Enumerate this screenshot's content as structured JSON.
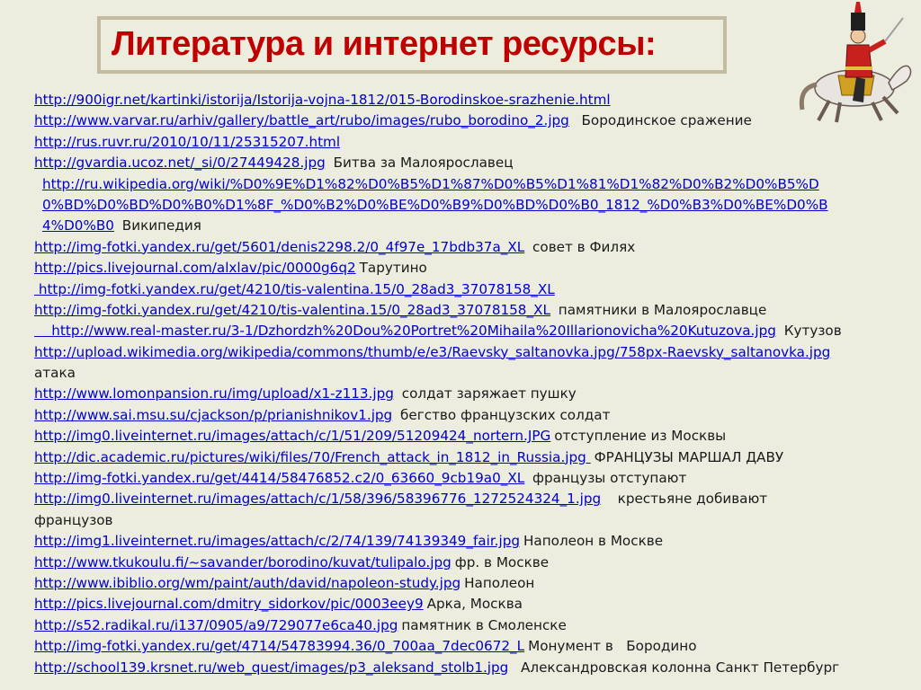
{
  "title": "Литература и интернет ресурсы:",
  "lines": [
    {
      "url": "http://900igr.net/kartinki/istorija/Istorija-vojna-1812/015-Borodinskoe-srazhenie.html",
      "desc": ""
    },
    {
      "url": "http://www.varvar.ru/arhiv/gallery/battle_art/rubo/images/rubo_borodino_2.jpg",
      "desc": "  Бородинское сражение"
    },
    {
      "url": "http://rus.ruvr.ru/2010/10/11/25315207.html",
      "desc": ""
    },
    {
      "url": "http://gvardia.ucoz.net/_si/0/27449428.jpg",
      "desc": " Битва за Малоярославец"
    },
    {
      "url": "http://ru.wikipedia.org/wiki/%D0%9E%D1%82%D0%B5%D1%87%D0%B5%D1%81%D1%82%D0%B2%D0%B5%D",
      "desc": "",
      "indent": true
    },
    {
      "url": "0%BD%D0%BD%D0%B0%D1%8F_%D0%B2%D0%BE%D0%B9%D0%BD%D0%B0_1812_%D0%B3%D0%BE%D0%B",
      "desc": "",
      "indent": true
    },
    {
      "url": "4%D0%B0",
      "desc": " Википедия",
      "indent": true
    },
    {
      "url": "http://img-fotki.yandex.ru/get/5601/denis2298.2/0_4f97e_17bdb37a_XL",
      "desc": " совет в Филях"
    },
    {
      "url": "http://pics.livejournal.com/alxlav/pic/0000g6q2",
      "desc": "Тарутино"
    },
    {
      "url": " http://img-fotki.yandex.ru/get/4210/tis-valentina.15/0_28ad3_37078158_XL",
      "desc": ""
    },
    {
      "url": "http://img-fotki.yandex.ru/get/4210/tis-valentina.15/0_28ad3_37078158_XL",
      "desc": " памятники в Малоярославце"
    },
    {
      "url": "    http://www.real-master.ru/3-1/Dzhordzh%20Dou%20Portret%20Mihaila%20Illarionovicha%20Kutuzova.jpg",
      "desc": " Кутузов"
    },
    {
      "url": "http://upload.wikimedia.org/wikipedia/commons/thumb/e/e3/Raevsky_saltanovka.jpg/758px-Raevsky_saltanovka.jpg",
      "desc": ""
    },
    {
      "url": "",
      "desc": "атака"
    },
    {
      "url": "http://www.lomonpansion.ru/img/upload/x1-z113.jpg",
      "desc": " солдат заряжает пушку"
    },
    {
      "url": "http://www.sai.msu.su/cjackson/p/prianishnikov1.jpg",
      "desc": " бегство французских солдат"
    },
    {
      "url": "http://img0.liveinternet.ru/images/attach/c/1/51/209/51209424_nortern.JPG",
      "desc": "отступление из Москвы"
    },
    {
      "url": "http://dic.academic.ru/pictures/wiki/files/70/French_attack_in_1812_in_Russia.jpg ",
      "desc": "ФРАНЦУЗЫ МАРШАЛ ДАВУ"
    },
    {
      "url": "http://img-fotki.yandex.ru/get/4414/58476852.c2/0_63660_9cb19a0_XL",
      "desc": " французы отступают"
    },
    {
      "url": "http://img0.liveinternet.ru/images/attach/c/1/58/396/58396776_1272524324_1.jpg",
      "desc": "   крестьяне добивают"
    },
    {
      "url": "",
      "desc": "французов"
    },
    {
      "url": "http://img1.liveinternet.ru/images/attach/c/2/74/139/74139349_fair.jpg",
      "desc": "Наполеон в Москве"
    },
    {
      "url": "http://www.tkukoulu.fi/~savander/borodino/kuvat/tulipalo.jpg",
      "desc": "фр. в Москве"
    },
    {
      "url": "http://www.ibiblio.org/wm/paint/auth/david/napoleon-study.jpg",
      "desc": "Наполеон"
    },
    {
      "url": "http://pics.livejournal.com/dmitry_sidorkov/pic/0003eey9",
      "desc": "Арка, Москва"
    },
    {
      "url": "http://s52.radikal.ru/i137/0905/a9/729077e6ca40.jpg",
      "desc": "памятник в Смоленске"
    },
    {
      "url": "http://img-fotki.yandex.ru/get/4714/54783994.36/0_700aa_7dec0672_L",
      "desc": "Монумент в   Бородино"
    },
    {
      "url": "http://school139.krsnet.ru/web_quest/images/p3_aleksand_stolb1.jpg",
      "desc": "  Александровская колонна Санкт Петербург"
    }
  ]
}
